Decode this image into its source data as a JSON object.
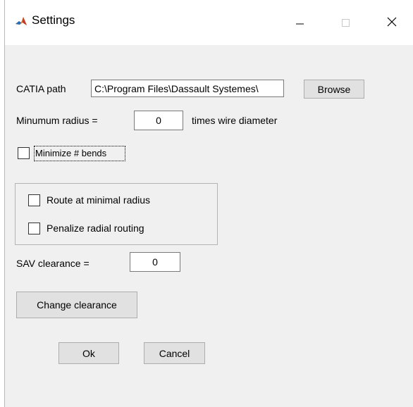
{
  "window": {
    "title": "Settings",
    "app_icon": "matlab-icon",
    "controls": {
      "minimize": "minimize-icon",
      "maximize": "maximize-icon",
      "close": "close-icon"
    }
  },
  "catia": {
    "label": "CATIA path",
    "value": "C:\\Program Files\\Dassault Systemes\\",
    "browse_label": "Browse"
  },
  "radius": {
    "label": "Minumum radius =",
    "value": "0",
    "suffix": "times wire diameter"
  },
  "minimize_bends": {
    "label": "Minimize # bends",
    "checked": false
  },
  "routing": {
    "route_minimal": {
      "label": "Route at minimal radius",
      "checked": false
    },
    "penalize_radial": {
      "label": "Penalize radial routing",
      "checked": false
    }
  },
  "sav": {
    "label": "SAV clearance =",
    "value": "0"
  },
  "change_clearance_label": "Change clearance",
  "ok_label": "Ok",
  "cancel_label": "Cancel"
}
